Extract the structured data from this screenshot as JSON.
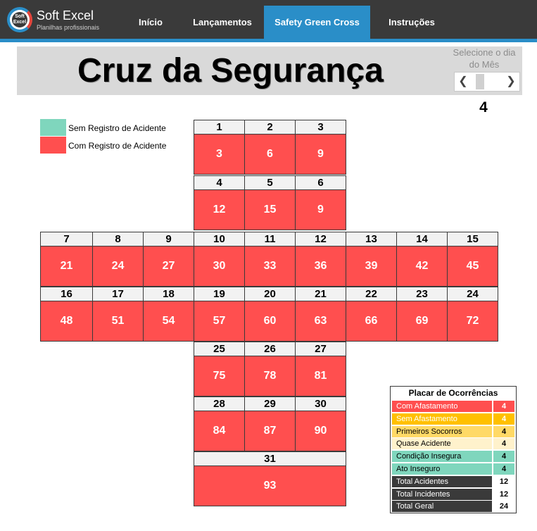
{
  "app": {
    "logo_text": "Soft Excel",
    "brand_name": "Soft Excel",
    "brand_subtitle": "Planilhas profissionais"
  },
  "nav": {
    "items": [
      {
        "label": "Início",
        "active": false
      },
      {
        "label": "Lançamentos",
        "active": false
      },
      {
        "label": "Safety Green Cross",
        "active": true
      },
      {
        "label": "Instruções",
        "active": false
      }
    ]
  },
  "page": {
    "title": "Cruz da Segurança",
    "day_selector_label": "Selecione o dia do Mês",
    "day_selected": "4"
  },
  "legend": [
    {
      "label": "Sem Registro de Acidente",
      "color": "#7fd6bd"
    },
    {
      "label": "Com Registro de Acidente",
      "color": "#ff4f4f"
    }
  ],
  "days": [
    {
      "day": "1",
      "value": "3",
      "status": "accident"
    },
    {
      "day": "2",
      "value": "6",
      "status": "accident"
    },
    {
      "day": "3",
      "value": "9",
      "status": "accident"
    },
    {
      "day": "4",
      "value": "12",
      "status": "accident"
    },
    {
      "day": "5",
      "value": "15",
      "status": "accident"
    },
    {
      "day": "6",
      "value": "9",
      "status": "accident"
    },
    {
      "day": "7",
      "value": "21",
      "status": "accident"
    },
    {
      "day": "8",
      "value": "24",
      "status": "accident"
    },
    {
      "day": "9",
      "value": "27",
      "status": "accident"
    },
    {
      "day": "10",
      "value": "30",
      "status": "accident"
    },
    {
      "day": "11",
      "value": "33",
      "status": "accident"
    },
    {
      "day": "12",
      "value": "36",
      "status": "accident"
    },
    {
      "day": "13",
      "value": "39",
      "status": "accident"
    },
    {
      "day": "14",
      "value": "42",
      "status": "accident"
    },
    {
      "day": "15",
      "value": "45",
      "status": "accident"
    },
    {
      "day": "16",
      "value": "48",
      "status": "accident"
    },
    {
      "day": "17",
      "value": "51",
      "status": "accident"
    },
    {
      "day": "18",
      "value": "54",
      "status": "accident"
    },
    {
      "day": "19",
      "value": "57",
      "status": "accident"
    },
    {
      "day": "20",
      "value": "60",
      "status": "accident"
    },
    {
      "day": "21",
      "value": "63",
      "status": "accident"
    },
    {
      "day": "22",
      "value": "66",
      "status": "accident"
    },
    {
      "day": "23",
      "value": "69",
      "status": "accident"
    },
    {
      "day": "24",
      "value": "72",
      "status": "accident"
    },
    {
      "day": "25",
      "value": "75",
      "status": "accident"
    },
    {
      "day": "26",
      "value": "78",
      "status": "accident"
    },
    {
      "day": "27",
      "value": "81",
      "status": "accident"
    },
    {
      "day": "28",
      "value": "84",
      "status": "accident"
    },
    {
      "day": "29",
      "value": "87",
      "status": "accident"
    },
    {
      "day": "30",
      "value": "90",
      "status": "accident"
    },
    {
      "day": "31",
      "value": "93",
      "status": "accident"
    }
  ],
  "scoreboard": {
    "title": "Placar de Ocorrências",
    "rows": [
      {
        "label": "Com Afastamento",
        "value": "4",
        "bg": "#ff4f4f",
        "fg": "#ffffff",
        "val_bg": "#ff4f4f",
        "val_fg": "#ffffff"
      },
      {
        "label": "Sem Afastamento",
        "value": "4",
        "bg": "#ffc000",
        "fg": "#ffffff",
        "val_bg": "#ffc000",
        "val_fg": "#ffffff"
      },
      {
        "label": "Primeiros Socorros",
        "value": "4",
        "bg": "#ffd966",
        "fg": "#000000",
        "val_bg": "#ffd966",
        "val_fg": "#000000"
      },
      {
        "label": "Quase Acidente",
        "value": "4",
        "bg": "#fff2cc",
        "fg": "#000000",
        "val_bg": "#fff2cc",
        "val_fg": "#000000"
      },
      {
        "label": "Condição Insegura",
        "value": "4",
        "bg": "#7fd6bd",
        "fg": "#000000",
        "val_bg": "#7fd6bd",
        "val_fg": "#000000"
      },
      {
        "label": "Ato Inseguro",
        "value": "4",
        "bg": "#7fd6bd",
        "fg": "#000000",
        "val_bg": "#7fd6bd",
        "val_fg": "#000000"
      },
      {
        "label": "Total Acidentes",
        "value": "12",
        "bg": "#3a3a3a",
        "fg": "#ffffff",
        "val_bg": "#ffffff",
        "val_fg": "#000000"
      },
      {
        "label": "Total Incidentes",
        "value": "12",
        "bg": "#3a3a3a",
        "fg": "#ffffff",
        "val_bg": "#ffffff",
        "val_fg": "#000000"
      },
      {
        "label": "Total Geral",
        "value": "24",
        "bg": "#3a3a3a",
        "fg": "#ffffff",
        "val_bg": "#ffffff",
        "val_fg": "#000000"
      }
    ]
  },
  "colors": {
    "accident": "#ff4f4f",
    "no_accident": "#7fd6bd",
    "nav_bg": "#3a3a3a",
    "nav_active": "#2a8ec8"
  }
}
